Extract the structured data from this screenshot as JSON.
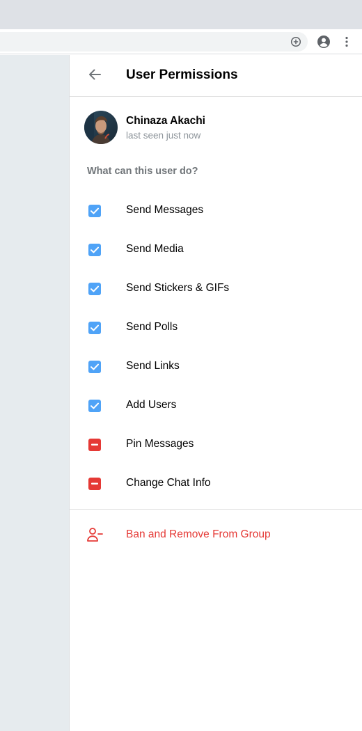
{
  "colors": {
    "checked": "#4fa3f7",
    "restricted": "#e53935",
    "danger_text": "#e53935"
  },
  "header": {
    "title": "User Permissions",
    "back_icon": "arrow-left-icon"
  },
  "user": {
    "name": "Chinaza Akachi",
    "status": "last seen just now"
  },
  "section": {
    "label": "What can this user do?"
  },
  "permissions": [
    {
      "label": "Send Messages",
      "state": "checked"
    },
    {
      "label": "Send Media",
      "state": "checked"
    },
    {
      "label": "Send Stickers & GIFs",
      "state": "checked"
    },
    {
      "label": "Send Polls",
      "state": "checked"
    },
    {
      "label": "Send Links",
      "state": "checked"
    },
    {
      "label": "Add Users",
      "state": "checked"
    },
    {
      "label": "Pin Messages",
      "state": "restricted"
    },
    {
      "label": "Change Chat Info",
      "state": "restricted"
    }
  ],
  "ban": {
    "label": "Ban and Remove From Group",
    "icon": "remove-user-icon"
  },
  "browser": {
    "icons": [
      "add-circle-icon",
      "account-icon",
      "more-vert-icon"
    ]
  }
}
